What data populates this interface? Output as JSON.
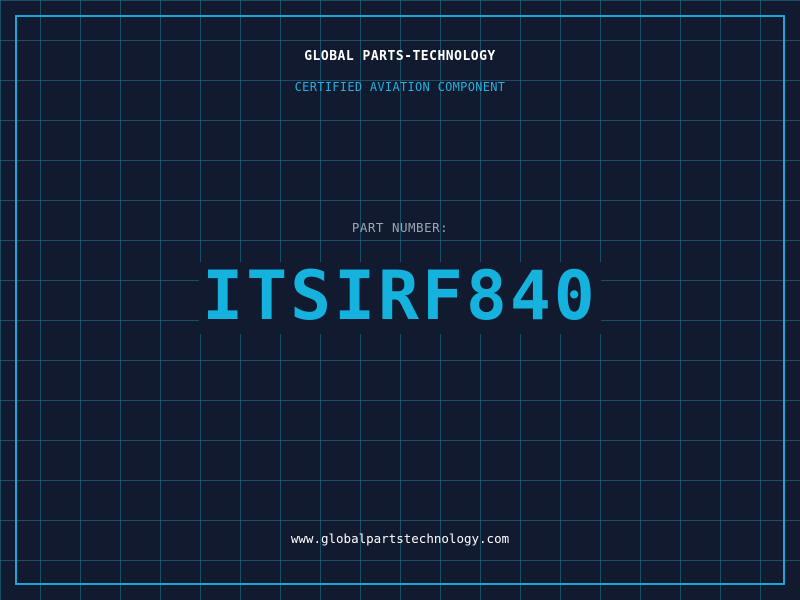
{
  "header": {
    "company": "GLOBAL PARTS-TECHNOLOGY",
    "tagline": "CERTIFIED AVIATION COMPONENT"
  },
  "part": {
    "label": "PART NUMBER:",
    "number": "ITSIRF840"
  },
  "footer": {
    "website": "www.globalpartstechnology.com"
  },
  "colors": {
    "background": "#111a2e",
    "grid": "#227896",
    "frame": "#1aa8d6",
    "accent": "#14b2dc",
    "label": "#9aa6b8",
    "text": "#ffffff"
  }
}
